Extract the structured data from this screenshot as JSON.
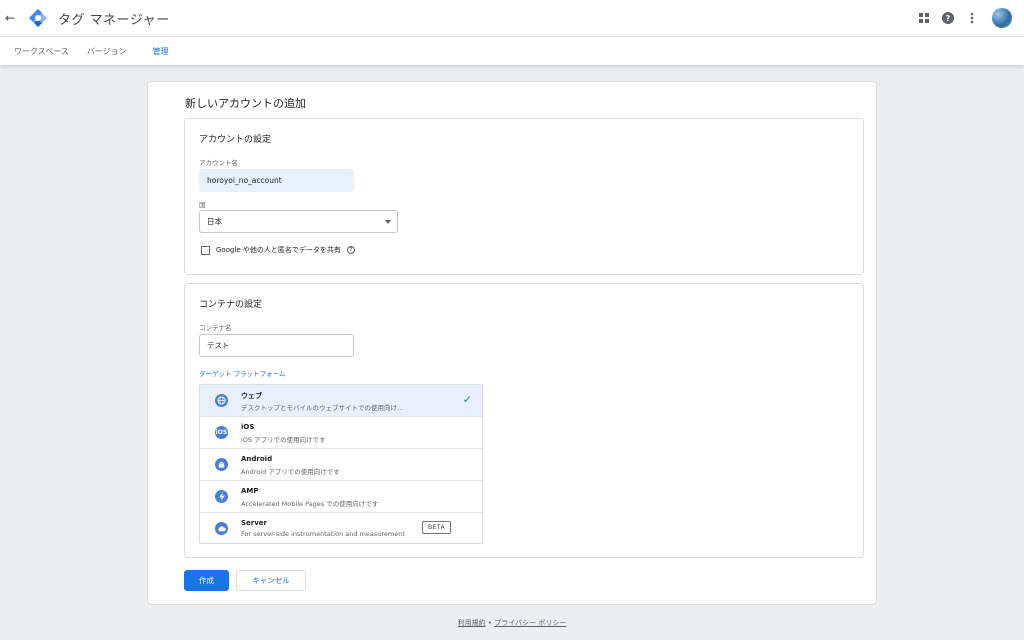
{
  "header": {
    "back_icon": "arrow-back-icon",
    "app_title": "タグ マネージャー",
    "brand_color": "#4285f4",
    "apps_icon": "grid-apps-icon",
    "help_icon": "help-circle-icon",
    "more_icon": "more-vert-icon"
  },
  "tabs": [
    {
      "label": "ワークスペース"
    },
    {
      "label": "バージョン"
    },
    {
      "label": "管理",
      "active": true
    }
  ],
  "card": {
    "title": "新しいアカウントの追加",
    "account_section": {
      "title": "アカウントの設定",
      "account_name_label": "アカウント名",
      "account_name_value": "horoyoi_no_account",
      "country_label": "国",
      "country_value": "日本",
      "share_label": "Google や他の人と匿名でデータを共有",
      "share_checked": false
    },
    "container_section": {
      "title": "コンテナの設定",
      "container_name_label": "コンテナ名",
      "container_name_value": "テスト",
      "target_platform_label": "ターゲット プラットフォーム",
      "platforms": [
        {
          "name": "ウェブ",
          "desc": "デスクトップとモバイルのウェブサイトでの使用向け...",
          "icon": "globe-icon",
          "selected": true
        },
        {
          "name": "iOS",
          "desc": "iOS アプリでの使用向けです",
          "icon": "ios-icon",
          "selected": false
        },
        {
          "name": "Android",
          "desc": "Android アプリでの使用向けです",
          "icon": "android-icon",
          "selected": false
        },
        {
          "name": "AMP",
          "desc": "Accelerated Mobile Pages での使用向けです",
          "icon": "amp-bolt-icon",
          "selected": false
        },
        {
          "name": "Server",
          "desc": "For server-side instrumentation and measurement",
          "icon": "cloud-icon",
          "selected": false,
          "badge": "BETA"
        }
      ]
    },
    "create_label": "作成",
    "cancel_label": "キャンセル"
  },
  "footer": {
    "terms": "利用規約",
    "separator": "•",
    "privacy": "プライバシー ポリシー"
  }
}
